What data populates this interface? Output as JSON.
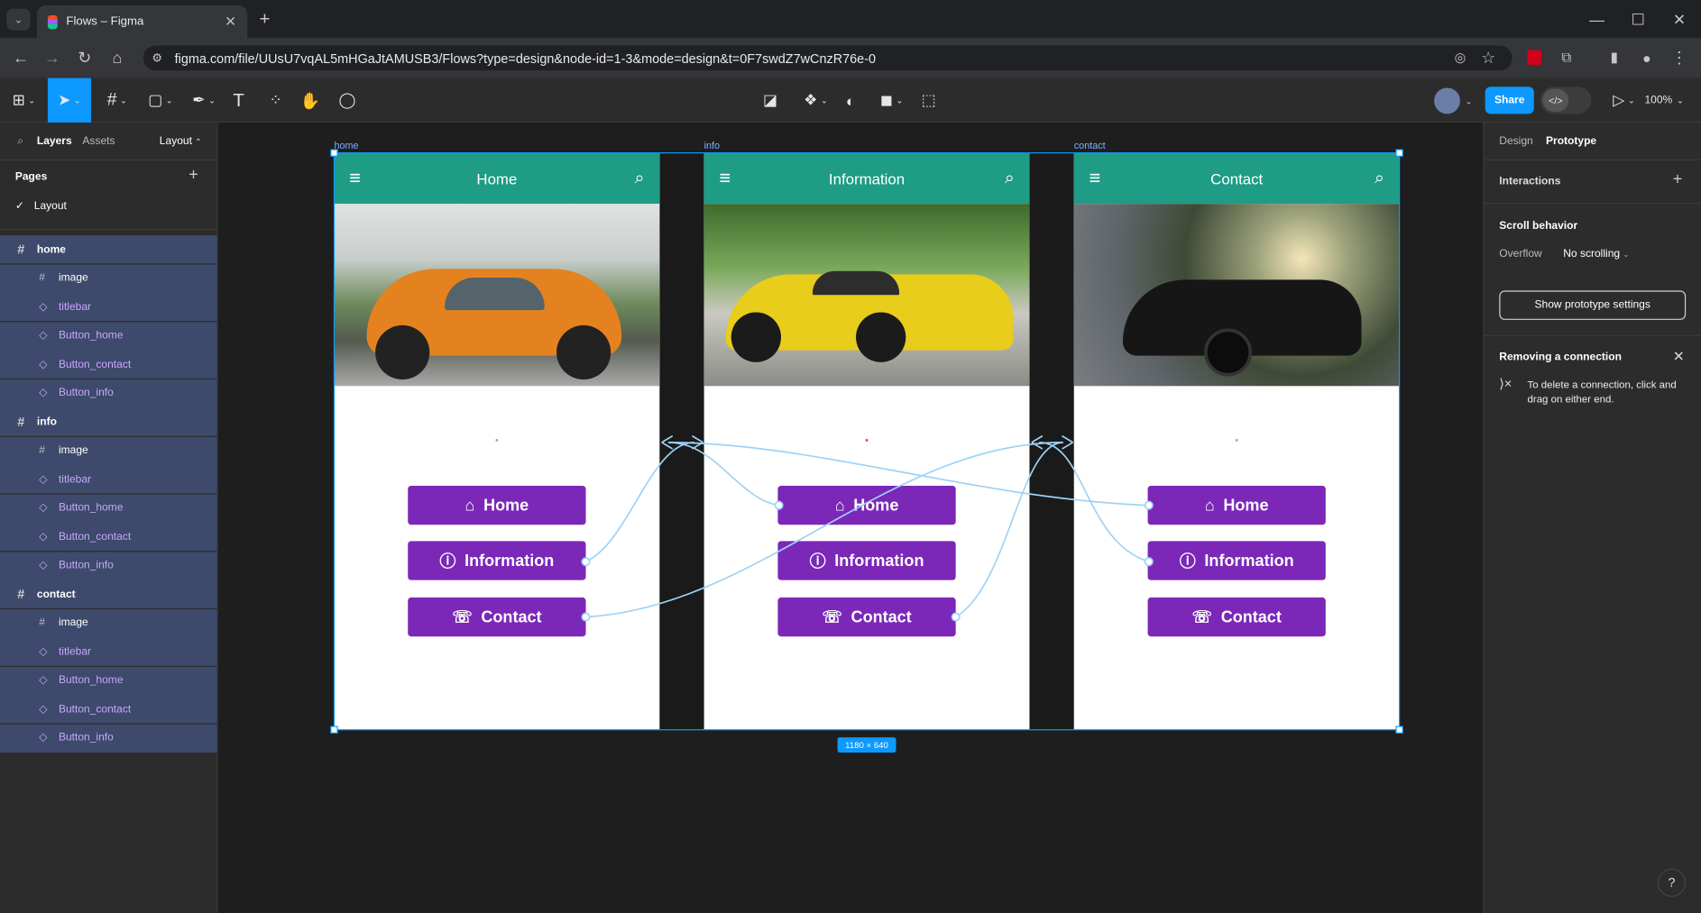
{
  "browser": {
    "tab_title": "Flows – Figma",
    "url": "figma.com/file/UUsU7vqAL5mHGaJtAMUSB3/Flows?type=design&node-id=1-3&mode=design&t=0F7swdZ7wCnzR76e-0"
  },
  "toolbar": {
    "share_label": "Share",
    "zoom": "100%"
  },
  "left_panel": {
    "tabs": [
      "Layers",
      "Assets"
    ],
    "page_dropdown": "Layout",
    "pages_heading": "Pages",
    "current_page": "Layout",
    "layers": [
      {
        "name": "home",
        "children": [
          "image",
          "titlebar",
          "Button_home",
          "Button_contact",
          "Button_info"
        ]
      },
      {
        "name": "info",
        "children": [
          "image",
          "titlebar",
          "Button_home",
          "Button_contact",
          "Button_info"
        ]
      },
      {
        "name": "contact",
        "children": [
          "image",
          "titlebar",
          "Button_home",
          "Button_contact",
          "Button_info"
        ]
      }
    ]
  },
  "canvas": {
    "frames": [
      {
        "label": "home",
        "title": "Home"
      },
      {
        "label": "info",
        "title": "Information"
      },
      {
        "label": "contact",
        "title": "Contact"
      }
    ],
    "buttons": {
      "home": "Home",
      "info": "Information",
      "contact": "Contact"
    },
    "selection_size": "1180 × 640"
  },
  "right_panel": {
    "tabs": [
      "Design",
      "Prototype"
    ],
    "interactions_label": "Interactions",
    "scroll_heading": "Scroll behavior",
    "overflow_label": "Overflow",
    "overflow_value": "No scrolling",
    "proto_settings_button": "Show prototype settings",
    "tip_title": "Removing a connection",
    "tip_text": "To delete a connection, click and drag on either end."
  },
  "help_label": "?"
}
